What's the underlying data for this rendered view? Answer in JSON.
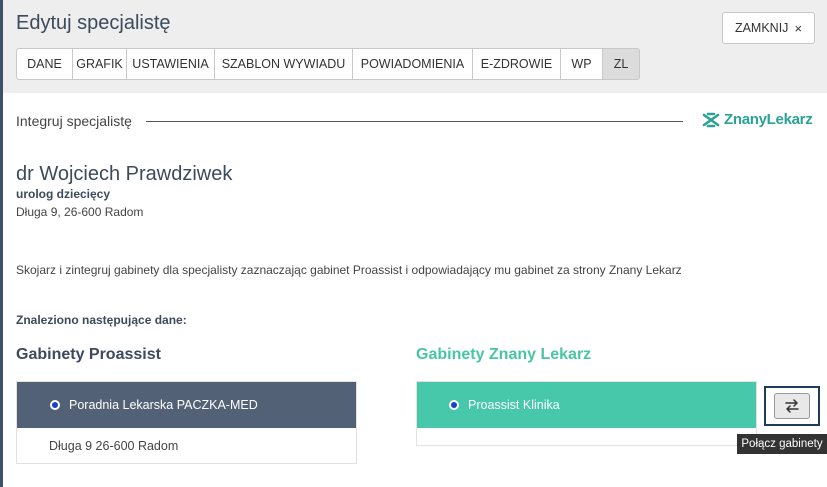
{
  "header": {
    "title": "Edytuj specjalistę",
    "close_label": "ZAMKNIJ",
    "close_icon": "×"
  },
  "tabs": [
    {
      "label": "DANE",
      "active": false
    },
    {
      "label": "GRAFIK",
      "active": false
    },
    {
      "label": "USTAWIENIA",
      "active": false
    },
    {
      "label": "SZABLON WYWIADU",
      "active": false
    },
    {
      "label": "POWIADOMIENIA",
      "active": false
    },
    {
      "label": "E-ZDROWIE",
      "active": false
    },
    {
      "label": "WP",
      "active": false
    },
    {
      "label": "ZL",
      "active": true
    }
  ],
  "section": {
    "title": "Integruj specjalistę",
    "logo_text": "ZnanyLekarz"
  },
  "doctor": {
    "name": "dr Wojciech Prawdziwek",
    "specialty": "urolog dziecięcy",
    "address": "Długa 9, 26-600 Radom"
  },
  "instruction": "Skojarz i zintegruj gabinety dla specjalisty zaznaczając gabinet Proassist i odpowiadający mu gabinet za strony Znany Lekarz",
  "found_label": "Znaleziono następujące dane:",
  "proassist": {
    "title": "Gabinety Proassist",
    "clinic_name": "Poradnia Lekarska PACZKA-MED",
    "clinic_address": "Długa 9 26-600 Radom"
  },
  "znanylekarz": {
    "title": "Gabinety Znany Lekarz",
    "clinic_name": "Proassist Klinika"
  },
  "connect": {
    "icon": "swap-arrows-icon",
    "tooltip": "Połącz gabinety"
  },
  "colors": {
    "header_bg": "#eeeeee",
    "dark_slate": "#536176",
    "teal": "#48c8ab",
    "brand_green": "#2aa395"
  }
}
